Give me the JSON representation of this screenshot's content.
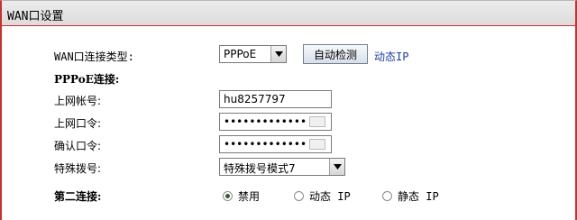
{
  "title": "WAN口设置",
  "wan_type": {
    "label": "WAN口连接类型:",
    "value": "PPPoE",
    "detect_button": "自动检测",
    "detected": "动态IP"
  },
  "pppoe": {
    "heading": "PPPoE连接:",
    "account_label": "上网帐号:",
    "account_value": "hu8257797",
    "password_label": "上网口令:",
    "password_value": "•••••••••••••",
    "confirm_label": "确认口令:",
    "confirm_value": "•••••••••••••",
    "dial_label": "特殊拨号:",
    "dial_value": "特殊拨号模式7"
  },
  "second_conn": {
    "label": "第二连接:",
    "options": [
      {
        "label": "禁用",
        "selected": true
      },
      {
        "label": "动态 IP",
        "selected": false
      },
      {
        "label": "静态 IP",
        "selected": false
      }
    ]
  },
  "colors": {
    "border": "#c9302c",
    "link": "#1c3fa8"
  },
  "icons": {
    "dropdown": "chevron-down-icon",
    "keyboard": "keyboard-icon"
  }
}
